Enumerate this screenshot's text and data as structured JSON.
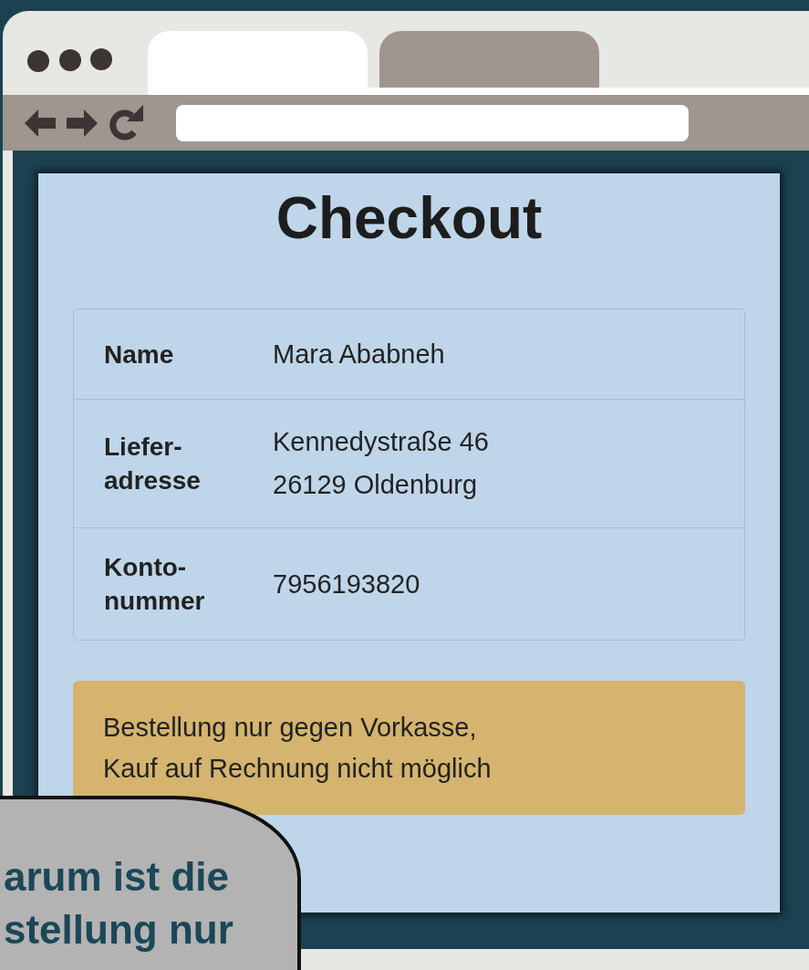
{
  "browser": {
    "tabs": [
      {
        "selected": true
      },
      {
        "selected": false
      }
    ]
  },
  "checkout": {
    "title": "Checkout",
    "rows": [
      {
        "label": "Name",
        "value": [
          "Mara Ababneh"
        ]
      },
      {
        "label": "Liefer-\nadresse",
        "value": [
          "Kennedystraße 46",
          "26129 Oldenburg"
        ]
      },
      {
        "label": "Konto-\nnummer",
        "value": [
          "7956193820"
        ]
      }
    ],
    "notice": "Bestellung nur gegen Vorkasse,\nKauf auf Rechnung nicht möglich"
  },
  "speech_bubble": {
    "lines": [
      "arum ist die",
      "stellung nur"
    ]
  }
}
